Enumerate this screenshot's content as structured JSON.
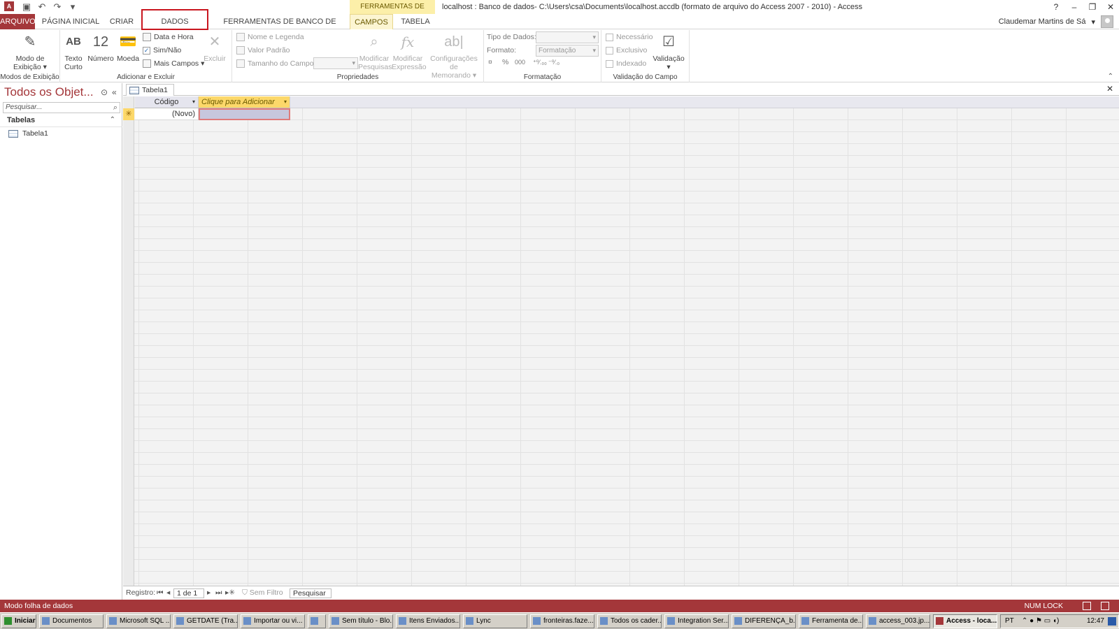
{
  "window": {
    "title": "localhost : Banco de dados- C:\\Users\\csa\\Documents\\localhost.accdb (formato de arquivo do Access 2007 - 2010) - Access",
    "contextual_group": "FERRAMENTAS DE TABELA",
    "help": "?",
    "minimize": "–",
    "restore": "❐",
    "close": "✕"
  },
  "tabs": {
    "file": "ARQUIVO",
    "home": "PÁGINA INICIAL",
    "create": "CRIAR",
    "external": "DADOS EXTERNOS",
    "dbtools": "FERRAMENTAS DE BANCO DE DADOS",
    "fields": "CAMPOS",
    "table": "TABELA"
  },
  "user": {
    "name": "Claudemar Martins de Sá"
  },
  "ribbon": {
    "views": {
      "label": "Modos de Exibição",
      "view_btn_l1": "Modo de",
      "view_btn_l2": "Exibição"
    },
    "addremove": {
      "label": "Adicionar e Excluir",
      "short_text_l1": "Texto",
      "short_text_l2": "Curto",
      "short_text_icon": "AB",
      "number": "Número",
      "number_icon": "12",
      "currency": "Moeda",
      "date_time": "Data e Hora",
      "yes_no": "Sim/Não",
      "more_fields": "Mais Campos",
      "delete": "Excluir"
    },
    "properties": {
      "label": "Propriedades",
      "name_caption": "Nome e Legenda",
      "default_value": "Valor Padrão",
      "field_size": "Tamanho do Campo",
      "modify_lookups_l1": "Modificar",
      "modify_lookups_l2": "Pesquisas",
      "modify_expr_l1": "Modificar",
      "modify_expr_l2": "Expressão",
      "memo_l1": "Configurações de",
      "memo_l2": "Memorando"
    },
    "formatting": {
      "label": "Formatação",
      "data_type": "Tipo de Dados:",
      "format": "Formato:",
      "format_value": "Formatação",
      "percent": "%",
      "thousands": "000",
      "inc_dec": "⁺⁰⁄.₀₀",
      "dec_dec": "⁻⁰⁄.₀"
    },
    "validation": {
      "label": "Validação do Campo",
      "required": "Necessário",
      "unique": "Exclusivo",
      "indexed": "Indexado",
      "validation": "Validação"
    }
  },
  "nav": {
    "title": "Todos os Objet...",
    "search_placeholder": "Pesquisar...",
    "group": "Tabelas",
    "items": [
      "Tabela1"
    ]
  },
  "document": {
    "tab": "Tabela1",
    "columns": {
      "code": "Código",
      "add": "Clique para Adicionar"
    },
    "new_row": {
      "marker": "✳",
      "code": "(Novo)"
    }
  },
  "recnav": {
    "label": "Registro:",
    "position": "1 de 1",
    "filter": "Sem Filtro",
    "search": "Pesquisar"
  },
  "status": {
    "message": "Modo folha de dados",
    "numlock": "NUM LOCK"
  },
  "taskbar": {
    "start": "Iniciar",
    "items": [
      "Documentos",
      "Microsoft SQL ...",
      "GETDATE (Tra...",
      "Importar ou vi...",
      "Sem título - Blo...",
      "Itens Enviados...",
      "Lync",
      "fronteiras.faze...",
      "Todos os cader...",
      "Integration Ser...",
      "DIFERENÇA_b...",
      "Ferramenta de...",
      "access_003.jp...",
      "Access - loca..."
    ],
    "lang": "PT",
    "clock": "12:47"
  }
}
